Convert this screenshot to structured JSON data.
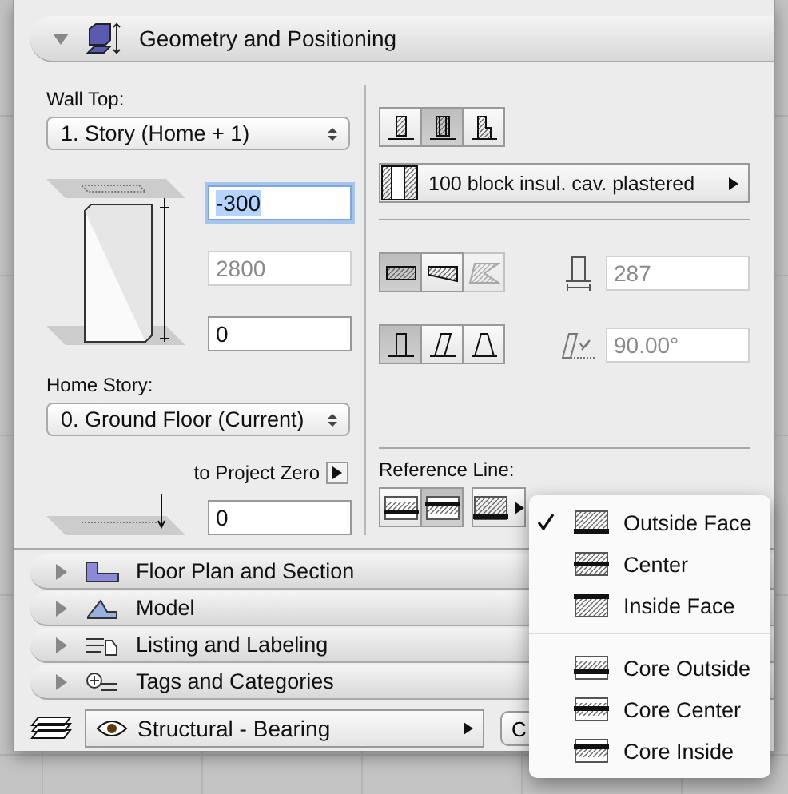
{
  "header": {
    "title": "Geometry and Positioning",
    "expanded": true
  },
  "wall_top": {
    "label": "Wall Top:",
    "value": "1. Story (Home + 1)"
  },
  "top_offset": {
    "value": "-300",
    "selected": true
  },
  "wall_height": {
    "value": "2800",
    "disabled": true
  },
  "base_offset": {
    "value": "0"
  },
  "home_story": {
    "label": "Home Story:",
    "value": "0. Ground Floor (Current)"
  },
  "project_zero": {
    "label": "to Project Zero",
    "value": "0"
  },
  "structure_buttons": [
    {
      "kind": "basic",
      "selected": false
    },
    {
      "kind": "composite",
      "selected": true
    },
    {
      "kind": "profile",
      "selected": false
    }
  ],
  "composite": {
    "value": "100 block insul. cav. plastered"
  },
  "geometry_buttons": [
    {
      "kind": "straight",
      "selected": true,
      "disabled": false
    },
    {
      "kind": "trapezoid",
      "selected": false,
      "disabled": false
    },
    {
      "kind": "polygonal",
      "selected": false,
      "disabled": true
    }
  ],
  "thickness": {
    "value": "287",
    "disabled": true
  },
  "slant_buttons": [
    {
      "kind": "perpendicular",
      "selected": true
    },
    {
      "kind": "slanted",
      "selected": false
    },
    {
      "kind": "double",
      "selected": false
    }
  ],
  "angle": {
    "value": "90.00°",
    "disabled": true
  },
  "reference_line": {
    "label": "Reference Line:",
    "buttons": [
      {
        "kind": "outside",
        "selected": false
      },
      {
        "kind": "inside",
        "selected": true
      },
      {
        "kind": "menu",
        "selected": false
      }
    ]
  },
  "reference_menu": {
    "groups": [
      [
        {
          "label": "Outside Face",
          "kind": "outside",
          "checked": true
        },
        {
          "label": "Center",
          "kind": "center",
          "checked": false
        },
        {
          "label": "Inside Face",
          "kind": "inside",
          "checked": false
        }
      ],
      [
        {
          "label": "Core Outside",
          "kind": "core-outside",
          "checked": false
        },
        {
          "label": "Core Center",
          "kind": "core-center",
          "checked": false
        },
        {
          "label": "Core Inside",
          "kind": "core-inside",
          "checked": false
        }
      ]
    ]
  },
  "sections": [
    {
      "title": "Floor Plan and Section",
      "kind": "plan",
      "expanded": false
    },
    {
      "title": "Model",
      "kind": "model",
      "expanded": false
    },
    {
      "title": "Listing and Labeling",
      "kind": "listing",
      "expanded": false
    },
    {
      "title": "Tags and Categories",
      "kind": "tags",
      "expanded": false
    }
  ],
  "layer": {
    "value": "Structural - Bearing"
  },
  "cancel_button": {
    "label": "C"
  }
}
